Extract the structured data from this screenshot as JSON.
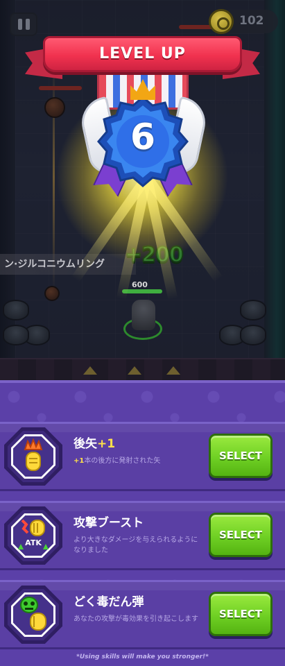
{
  "hud": {
    "coins": "102",
    "pause_icon": "pause-icon",
    "coin_icon": "coin-icon"
  },
  "battle": {
    "skill_toast": "ン·ジルコニウムリング",
    "xp_gain": "+200",
    "player_hp": "600"
  },
  "level_up": {
    "title": "LEVEL UP",
    "level": "6",
    "colors": {
      "ribbon": "#f1324f",
      "medal": "#2f6fe8",
      "glow": "#f5e03c"
    }
  },
  "skills": [
    {
      "title": "後矢",
      "title_suffix": "+1",
      "desc_prefix": "+1",
      "desc": "本の後方に発射された矢",
      "icon": "rear-arrow-icon",
      "button": "SELECT"
    },
    {
      "title": "攻撃ブースト",
      "title_suffix": "",
      "desc_prefix": "",
      "desc": "より大きなダメージを与えられるようになりました",
      "icon": "attack-boost-icon",
      "icon_label": "ATK",
      "button": "SELECT"
    },
    {
      "title": "どく毒だん弾",
      "title_suffix": "",
      "desc_prefix": "",
      "desc": "あなたの攻撃が毒効果を引き起こします",
      "icon": "poison-bullet-icon",
      "button": "SELECT"
    }
  ],
  "footer_note": "*Using skills will make you stronger!*",
  "colors": {
    "panel": "#5b40a8",
    "select_button": "#6fd024",
    "accent_yellow": "#ffe14a"
  }
}
